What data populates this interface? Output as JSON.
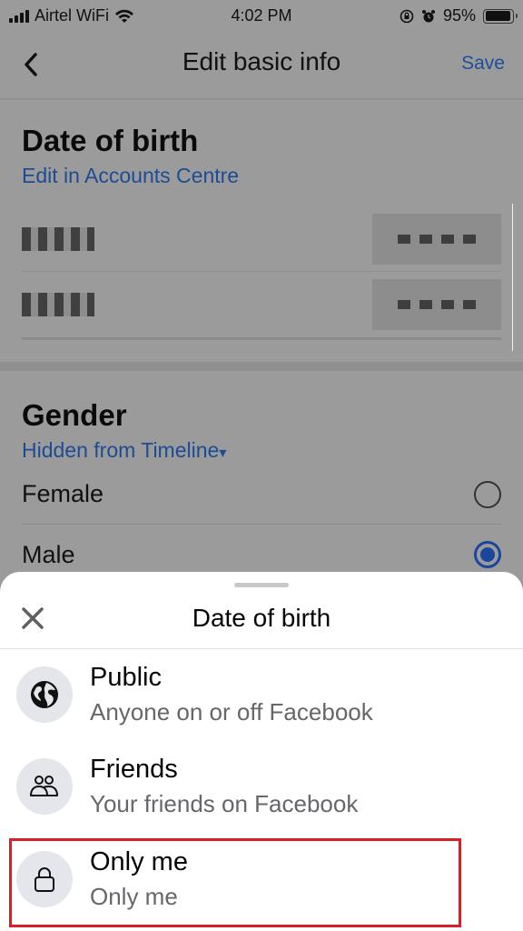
{
  "status_bar": {
    "carrier": "Airtel WiFi",
    "time": "4:02 PM",
    "battery_percent": "95%",
    "battery_level": 0.95,
    "icons": [
      "signal-icon",
      "wifi-icon",
      "orientation-lock-icon",
      "alarm-icon",
      "battery-icon"
    ]
  },
  "header": {
    "back_icon": "chevron-left-icon",
    "title": "Edit basic info",
    "save_label": "Save"
  },
  "date_of_birth": {
    "title": "Date of birth",
    "link": "Edit in Accounts Centre",
    "rows": [
      {
        "label": "[redacted]",
        "value": "[redacted]"
      },
      {
        "label": "[redacted]",
        "value": "[redacted]"
      }
    ]
  },
  "gender": {
    "title": "Gender",
    "audience_link": "Hidden from Timeline",
    "audience_caret": "▾",
    "options": [
      {
        "label": "Female",
        "selected": false
      },
      {
        "label": "Male",
        "selected": true
      }
    ]
  },
  "sheet": {
    "title": "Date of birth",
    "close_icon": "close-icon",
    "options": [
      {
        "label": "Public",
        "sub": "Anyone on or off Facebook",
        "icon": "globe-icon"
      },
      {
        "label": "Friends",
        "sub": "Your friends on Facebook",
        "icon": "friends-icon"
      },
      {
        "label": "Only me",
        "sub": "Only me",
        "icon": "lock-icon",
        "highlighted": true
      }
    ]
  },
  "colors": {
    "link_blue": "#1d4c95",
    "highlight_red": "#d42027",
    "icon_bg": "#e4e6eb"
  }
}
